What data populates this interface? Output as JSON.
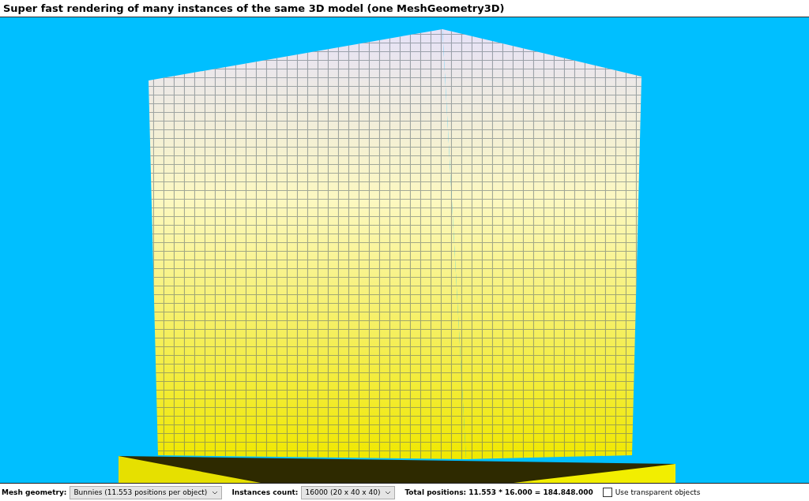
{
  "window": {
    "title": "Super fast rendering of many instances of the same 3D model (one MeshGeometry3D)"
  },
  "toolbar": {
    "mesh_geometry": {
      "label": "Mesh geometry:",
      "value": "Bunnies (11.553 positions per object)"
    },
    "instances_count": {
      "label": "Instances count:",
      "value": "16000 (20 x 40 x 40)"
    },
    "total_positions": "Total positions: 11.553 * 16.000 = 184.848.000",
    "transparent": {
      "label": "Use transparent objects",
      "checked": false
    }
  }
}
